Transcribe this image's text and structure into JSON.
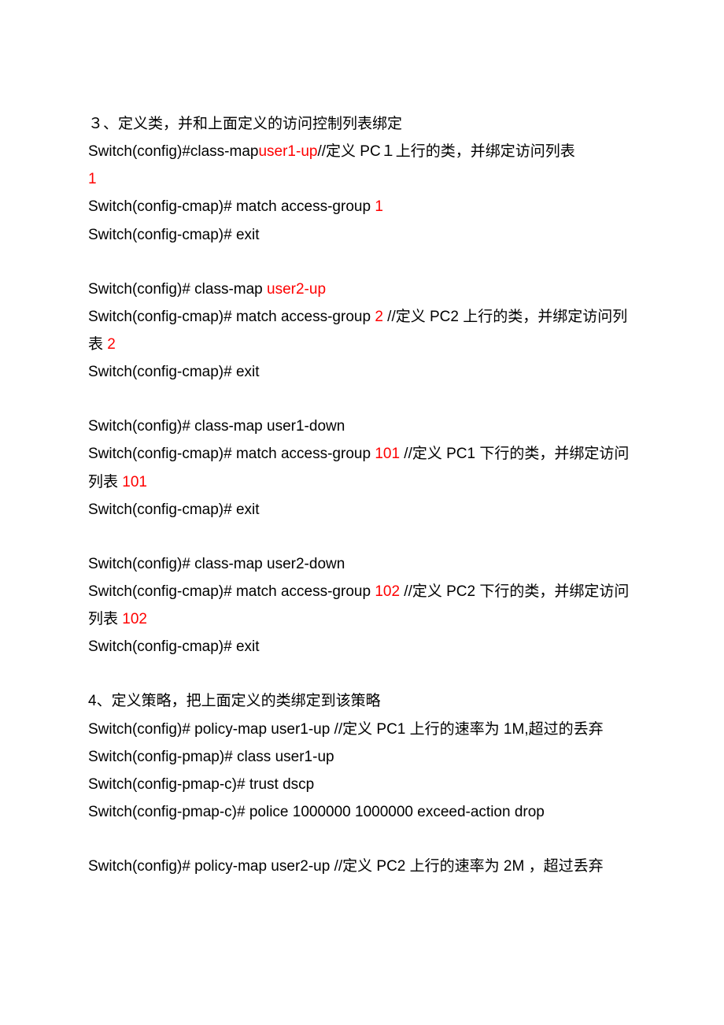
{
  "sec3": {
    "title_a": "３、定义类，并和上面定义的访问控制列表绑定",
    "l1a": "Switch(config)#class-map",
    "l1b_red": "user1-up",
    "l1c": "//定义 PC１上行的类，并绑定访问列表",
    "l1d_red": "1",
    "l2a": "Switch(config-cmap)# match access-group ",
    "l2b_red": "1",
    "l3": "Switch(config-cmap)# exit",
    "l4a": "Switch(config)# class-map ",
    "l4b_red": "user2-up",
    "l5a": "Switch(config-cmap)# match access-group ",
    "l5b_red": "2",
    "l5c": " //定义 PC2 上行的类，并绑定访问列表 ",
    "l5d_red": "2",
    "l6": "Switch(config-cmap)# exit",
    "l7": "Switch(config)# class-map user1-down",
    "l8a": "Switch(config-cmap)# match access-group ",
    "l8b_red": "101",
    "l8c": " //定义 PC1 下行的类，并绑定访问列表 ",
    "l8d_red": "101",
    "l9": "Switch(config-cmap)# exit",
    "l10": "Switch(config)# class-map user2-down",
    "l11a": "Switch(config-cmap)# match access-group ",
    "l11b_red": "102",
    "l11c": " //定义 PC2 下行的类，并绑定访问列表 ",
    "l11d_red": "102",
    "l12": "Switch(config-cmap)# exit"
  },
  "sec4": {
    "title": "4、定义策略，把上面定义的类绑定到该策略",
    "l1": "Switch(config)# policy-map user1-up //定义 PC1 上行的速率为 1M,超过的丢弃",
    "l2": "Switch(config-pmap)# class user1-up",
    "l3": "Switch(config-pmap-c)# trust dscp",
    "l4": "Switch(config-pmap-c)# police 1000000 1000000 exceed-action drop",
    "l5": "Switch(config)# policy-map user2-up //定义 PC2 上行的速率为 2M ，超过丢弃"
  }
}
